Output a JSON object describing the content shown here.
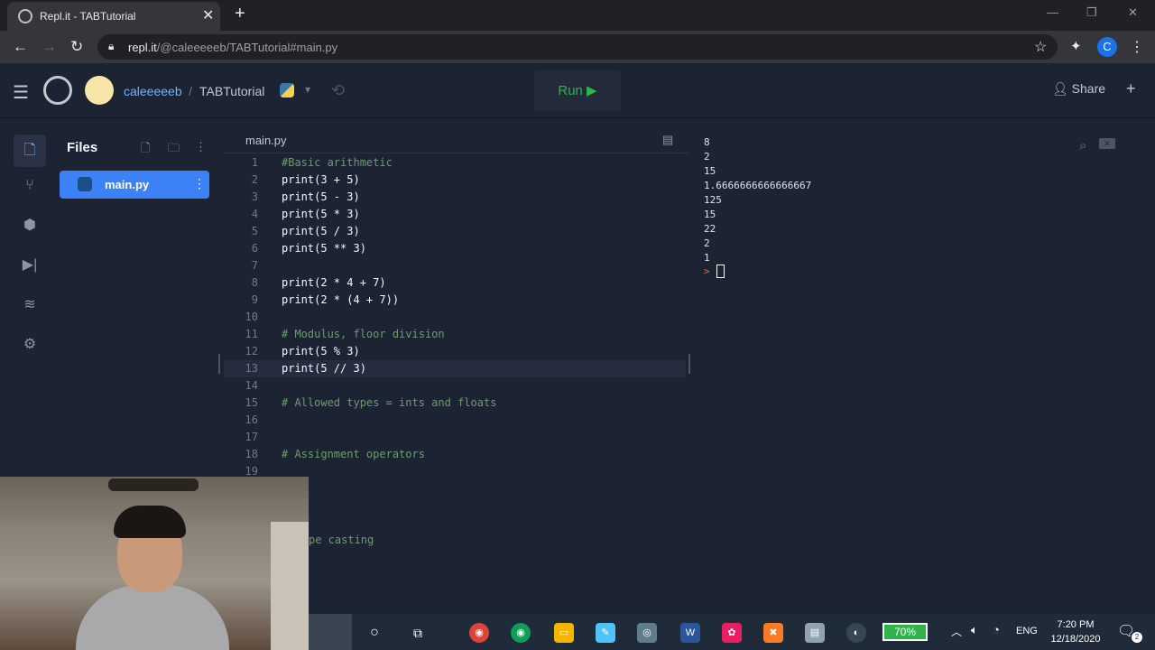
{
  "browser": {
    "tab_title": "Repl.it - TABTutorial",
    "url_host": "repl.it",
    "url_path": "/@caleeeeeb/TABTutorial#main.py",
    "profile_initial": "C"
  },
  "header": {
    "username": "caleeeeeb",
    "separator": "/",
    "project": "TABTutorial",
    "run_label": "Run ▶",
    "share_label": "Share",
    "language_icon": "python-icon"
  },
  "files_panel": {
    "title": "Files",
    "files": [
      {
        "name": "main.py"
      }
    ]
  },
  "editor": {
    "tab": "main.py",
    "active_line": 13,
    "lines": [
      {
        "n": "1",
        "t": "#Basic arithmetic",
        "comment": true
      },
      {
        "n": "2",
        "t": "print(3 + 5)"
      },
      {
        "n": "3",
        "t": "print(5 - 3)"
      },
      {
        "n": "4",
        "t": "print(5 * 3)"
      },
      {
        "n": "5",
        "t": "print(5 / 3)"
      },
      {
        "n": "6",
        "t": "print(5 ** 3)"
      },
      {
        "n": "7",
        "t": ""
      },
      {
        "n": "8",
        "t": "print(2 * 4 + 7)"
      },
      {
        "n": "9",
        "t": "print(2 * (4 + 7))"
      },
      {
        "n": "10",
        "t": ""
      },
      {
        "n": "11",
        "t": "# Modulus, floor division",
        "comment": true
      },
      {
        "n": "12",
        "t": "print(5 % 3)"
      },
      {
        "n": "13",
        "t": "print(5 // 3)"
      },
      {
        "n": "14",
        "t": ""
      },
      {
        "n": "15",
        "t": "# Allowed types = ints and floats",
        "comment": true
      },
      {
        "n": "16",
        "t": ""
      },
      {
        "n": "17",
        "t": ""
      },
      {
        "n": "18",
        "t": "# Assignment operators",
        "comment": true
      },
      {
        "n": "19",
        "t": ""
      }
    ],
    "partial_visible_comment": "pe casting"
  },
  "console": {
    "output": [
      "8",
      "2",
      "15",
      "1.6666666666666667",
      "125",
      "15",
      "22",
      "2",
      "1"
    ],
    "prompt": ">"
  },
  "taskbar": {
    "battery": "70%",
    "language": "ENG",
    "time": "7:20 PM",
    "date": "12/18/2020",
    "notification_count": "2"
  }
}
